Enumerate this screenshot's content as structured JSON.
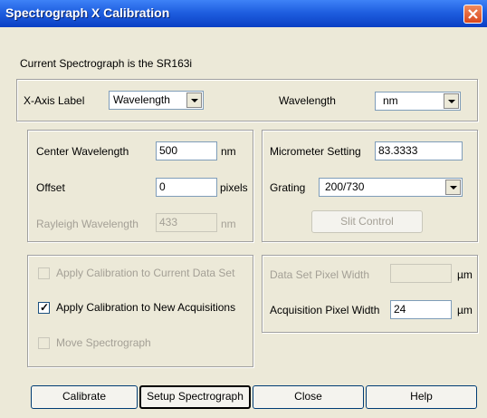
{
  "window": {
    "title": "Spectrograph X Calibration",
    "close_glyph": "✕"
  },
  "status": {
    "current_text": "Current Spectrograph is the SR163i"
  },
  "axis": {
    "label_text": "X-Axis Label",
    "label_value": "Wavelength",
    "units_label": "Wavelength",
    "units_value": "nm"
  },
  "left_panel": {
    "center_label": "Center Wavelength",
    "center_value": "500",
    "center_unit": "nm",
    "offset_label": "Offset",
    "offset_value": "0",
    "offset_unit": "pixels",
    "rayleigh_label": "Rayleigh Wavelength",
    "rayleigh_value": "433",
    "rayleigh_unit": "nm"
  },
  "right_panel": {
    "micrometer_label": "Micrometer Setting",
    "micrometer_value": "83.3333",
    "grating_label": "Grating",
    "grating_value": "200/730",
    "slit_button": "Slit Control"
  },
  "options": {
    "apply_current": {
      "label": "Apply Calibration to Current Data Set",
      "checked": false,
      "enabled": false
    },
    "apply_new": {
      "label": "Apply Calibration to New Acquisitions",
      "checked": true,
      "enabled": true,
      "mark": "✓"
    },
    "move": {
      "label": "Move Spectrograph",
      "checked": false,
      "enabled": false
    }
  },
  "pixel_panel": {
    "data_set_label": "Data Set Pixel Width",
    "data_set_value": "",
    "data_set_unit": "µm",
    "acq_label": "Acquisition Pixel Width",
    "acq_value": "24",
    "acq_unit": "µm"
  },
  "buttons": {
    "calibrate": "Calibrate",
    "setup": "Setup Spectrograph",
    "close": "Close",
    "help": "Help"
  }
}
